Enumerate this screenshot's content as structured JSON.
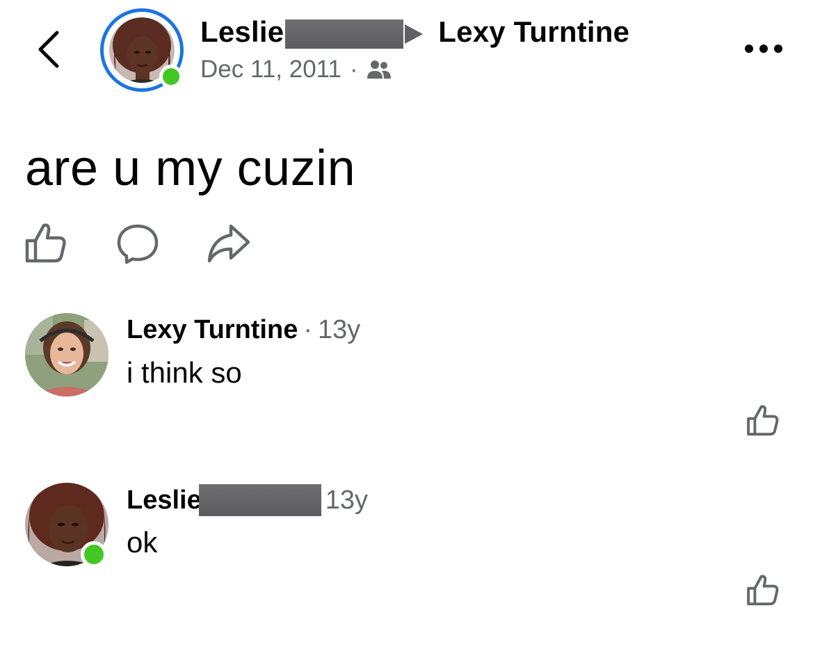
{
  "header": {
    "author_first": "Leslie",
    "target_name": "Lexy Turntine",
    "date": "Dec 11, 2011",
    "separator": "·",
    "audience_icon": "friends-icon",
    "online_color": "#43c723",
    "ring_color": "#1b74e4"
  },
  "post": {
    "text": "are u my cuzin",
    "actions": [
      "like-icon",
      "comment-icon",
      "share-icon"
    ]
  },
  "comments": [
    {
      "author": "Lexy Turntine",
      "separator": "·",
      "time": "13y",
      "text": "i think so"
    },
    {
      "author": "Leslie",
      "time": "13y",
      "text": "ok",
      "online": true
    }
  ]
}
